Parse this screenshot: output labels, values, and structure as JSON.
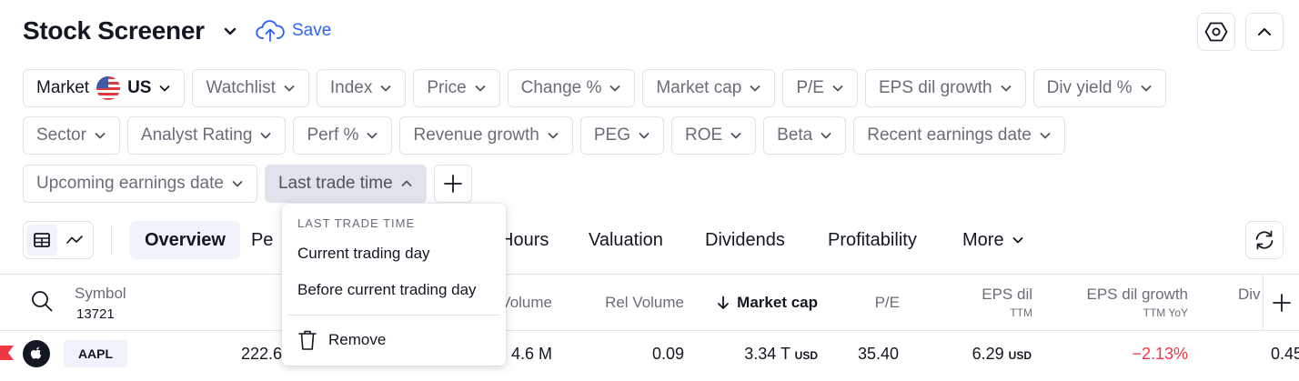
{
  "header": {
    "title": "Stock Screener",
    "save_label": "Save"
  },
  "filters": {
    "row1": [
      "Market",
      "Watchlist",
      "Index",
      "Price",
      "Change %",
      "Market cap",
      "P/E",
      "EPS dil growth",
      "Div yield %"
    ],
    "market_value": "US",
    "row2": [
      "Sector",
      "Analyst Rating",
      "Perf %",
      "Revenue growth",
      "PEG",
      "ROE",
      "Beta",
      "Recent earnings date"
    ],
    "row3": [
      "Upcoming earnings date",
      "Last trade time"
    ]
  },
  "tabs": {
    "overview": "Overview",
    "perf_partial": "Pe",
    "hours_partial": "Hours",
    "valuation": "Valuation",
    "dividends": "Dividends",
    "profitability": "Profitability",
    "more": "More"
  },
  "dropdown": {
    "heading": "LAST TRADE TIME",
    "items": [
      "Current trading day",
      "Before current trading day"
    ],
    "remove": "Remove"
  },
  "table": {
    "symbol_header": "Symbol",
    "symbol_count": "13721",
    "volume_partial": "Volume",
    "rel_volume": "Rel Volume",
    "market_cap": "Market cap",
    "pe": "P/E",
    "eps_dil": "EPS dil",
    "eps_dil_sub": "TTM",
    "eps_growth": "EPS dil growth",
    "eps_growth_sub": "TTM YoY",
    "div_partial": "Div",
    "row": {
      "ticker": "AAPL",
      "price_partial": "222.6",
      "volume_partial": "4.6 M",
      "rel_volume": "0.09",
      "market_cap": "3.34 T",
      "market_cap_unit": "USD",
      "pe": "35.40",
      "eps_dil": "6.29",
      "eps_dil_unit": "USD",
      "eps_growth": "−2.13%",
      "div_partial": "0.45"
    }
  },
  "colors": {
    "accent": "#2962ff",
    "negative": "#f23645",
    "flag_marker": "#f23645"
  }
}
